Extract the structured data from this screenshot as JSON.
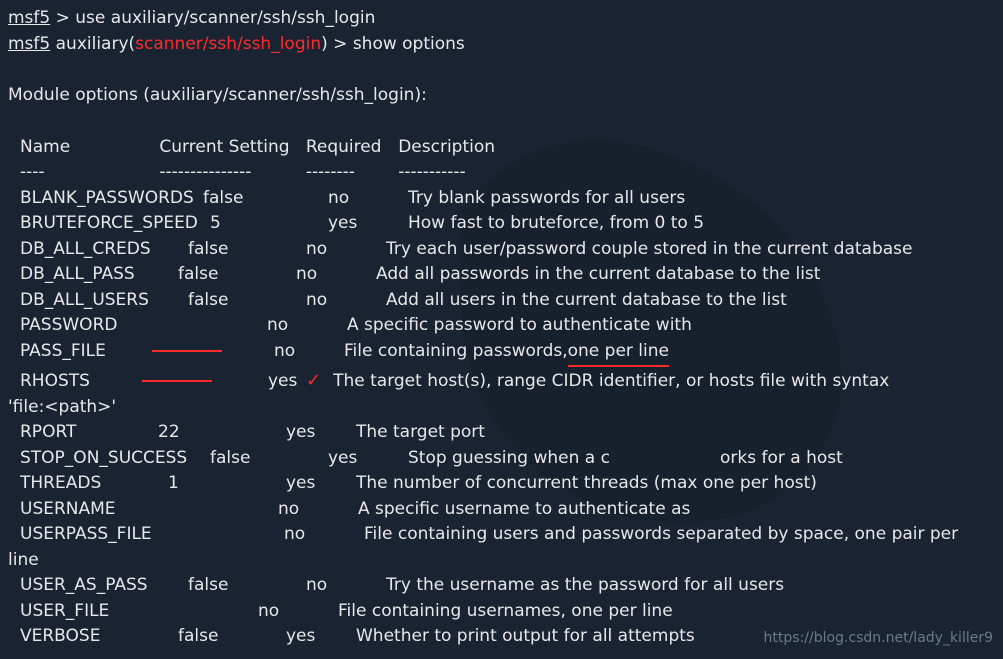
{
  "prompt1": {
    "prefix": "msf5",
    "gt": " > ",
    "cmd": "use auxiliary/scanner/ssh/ssh_login"
  },
  "prompt2": {
    "prefix": "msf5",
    "aux": " auxiliary(",
    "module": "scanner/ssh/ssh_login",
    "close": ") > ",
    "cmd": "show options"
  },
  "module_header": "Module options (auxiliary/scanner/ssh/ssh_login):",
  "headers": {
    "name": "Name",
    "setting": "Current Setting",
    "required": "Required",
    "description": "Description"
  },
  "dashes": {
    "name": "----",
    "setting": "---------------",
    "required": "--------",
    "description": "-----------"
  },
  "opts": {
    "blank_passwords": {
      "name": "BLANK_PASSWORDS",
      "setting": "false",
      "req": "no",
      "desc": "Try blank passwords for all users"
    },
    "bruteforce_speed": {
      "name": "BRUTEFORCE_SPEED",
      "setting": "5",
      "req": "yes",
      "desc": "How fast to bruteforce, from 0 to 5"
    },
    "db_all_creds": {
      "name": "DB_ALL_CREDS",
      "setting": "false",
      "req": "no",
      "desc": "Try each user/password couple stored in the current database"
    },
    "db_all_pass": {
      "name": "DB_ALL_PASS",
      "setting": "false",
      "req": "no",
      "desc": "Add all passwords in the current database to the list"
    },
    "db_all_users": {
      "name": "DB_ALL_USERS",
      "setting": "false",
      "req": "no",
      "desc": "Add all users in the current database to the list"
    },
    "password": {
      "name": "PASSWORD",
      "setting": "",
      "req": "no",
      "desc": "A specific password to authenticate with"
    },
    "pass_file": {
      "name": "PASS_FILE",
      "setting": "",
      "req": "no",
      "desc_pre": "File containing passwords, ",
      "desc_ann": "one per line"
    },
    "rhosts": {
      "name": "RHOSTS",
      "setting": "",
      "req": "yes",
      "desc": "The target host(s), range CIDR identifier, or hosts file with syntax "
    },
    "rhosts_cont": "'file:<path>'",
    "rport": {
      "name": "RPORT",
      "setting": "22",
      "req": "yes",
      "desc": "The target port"
    },
    "stop_on_success": {
      "name": "STOP_ON_SUCCESS",
      "setting": "false",
      "req": "yes",
      "desc_pre": "Stop guessing when a c",
      "desc_gap": "                      ",
      "desc_post": "orks for a host"
    },
    "threads": {
      "name": "THREADS",
      "setting": "1",
      "req": "yes",
      "desc": "The number of concurrent threads (max one per host)"
    },
    "username": {
      "name": "USERNAME",
      "setting": "",
      "req": "no",
      "desc": "A specific username to authenticate as"
    },
    "userpass_file": {
      "name": "USERPASS_FILE",
      "setting": "",
      "req": "no",
      "desc": "File containing users and passwords separated by space, one pair per"
    },
    "userpass_cont": "line",
    "user_as_pass": {
      "name": "USER_AS_PASS",
      "setting": "false",
      "req": "no",
      "desc": "Try the username as the password for all users"
    },
    "user_file": {
      "name": "USER_FILE",
      "setting": "",
      "req": "no",
      "desc": "File containing usernames, one per line"
    },
    "verbose": {
      "name": "VERBOSE",
      "setting": "false",
      "req": "yes",
      "desc": "Whether to print output for all attempts"
    }
  },
  "watermark": "https://blog.csdn.net/lady_killer9"
}
